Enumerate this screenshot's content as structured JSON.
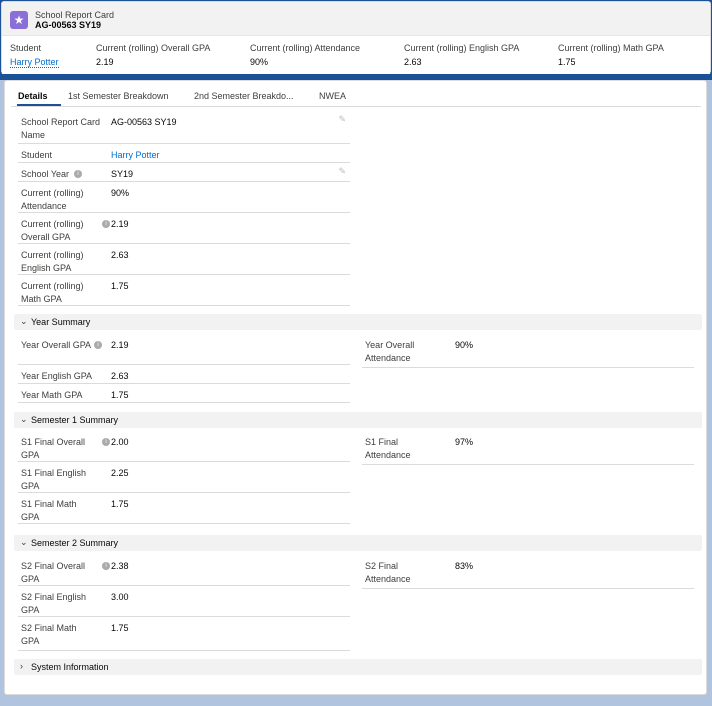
{
  "header": {
    "object_type": "School Report Card",
    "record_name": "AG-00563 SY19",
    "icon": "star-icon",
    "icon_color": "#8b6fd9"
  },
  "highlights": [
    {
      "label": "Student",
      "value": "Harry Potter",
      "link": true
    },
    {
      "label": "Current (rolling) Overall GPA",
      "value": "2.19"
    },
    {
      "label": "Current (rolling) Attendance",
      "value": "90%"
    },
    {
      "label": "Current (rolling) English GPA",
      "value": "2.63"
    },
    {
      "label": "Current (rolling) Math GPA",
      "value": "1.75"
    }
  ],
  "tabs": [
    "Details",
    "1st Semester Breakdown",
    "2nd Semester Breakdo...",
    "NWEA"
  ],
  "details": {
    "report_card_name_label": "School Report Card Name",
    "report_card_name_value": "AG-00563 SY19",
    "student_label": "Student",
    "student_value": "Harry Potter",
    "school_year_label": "School Year",
    "school_year_value": "SY19",
    "attendance_label": "Current (rolling) Attendance",
    "attendance_value": "90%",
    "overall_gpa_label": "Current (rolling) Overall GPA",
    "overall_gpa_value": "2.19",
    "english_gpa_label": "Current (rolling) English GPA",
    "english_gpa_value": "2.63",
    "math_gpa_label": "Current (rolling) Math GPA",
    "math_gpa_value": "1.75"
  },
  "year_summary": {
    "title": "Year Summary",
    "overall_gpa_label": "Year Overall GPA",
    "overall_gpa_value": "2.19",
    "attendance_label": "Year Overall Attendance",
    "attendance_value": "90%",
    "english_gpa_label": "Year English GPA",
    "english_gpa_value": "2.63",
    "math_gpa_label": "Year Math GPA",
    "math_gpa_value": "1.75"
  },
  "semester1": {
    "title": "Semester 1 Summary",
    "overall_gpa_label": "S1 Final Overall GPA",
    "overall_gpa_value": "2.00",
    "attendance_label": "S1 Final Attendance",
    "attendance_value": "97%",
    "english_gpa_label": "S1 Final English GPA",
    "english_gpa_value": "2.25",
    "math_gpa_label": "S1 Final Math GPA",
    "math_gpa_value": "1.75"
  },
  "semester2": {
    "title": "Semester 2 Summary",
    "overall_gpa_label": "S2 Final Overall GPA",
    "overall_gpa_value": "2.38",
    "attendance_label": "S2 Final Attendance",
    "attendance_value": "83%",
    "english_gpa_label": "S2 Final English GPA",
    "english_gpa_value": "3.00",
    "math_gpa_label": "S2 Final Math GPA",
    "math_gpa_value": "1.75"
  },
  "system_info": {
    "title": "System Information"
  }
}
